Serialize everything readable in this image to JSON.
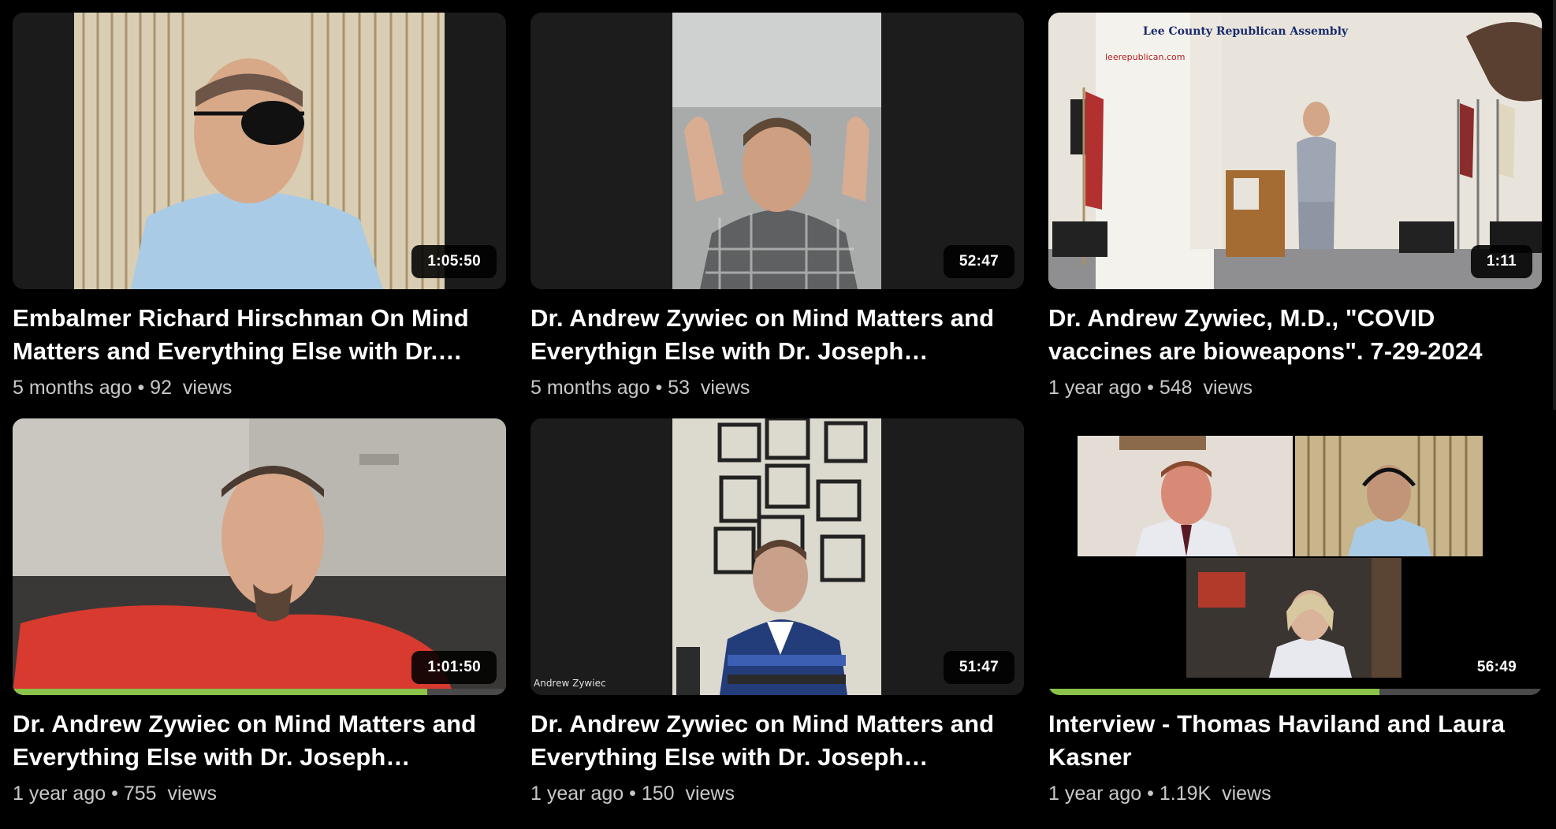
{
  "videos": [
    {
      "title": "Embalmer Richard Hirschman On Mind Matters and Everything Else with Dr.…",
      "duration": "1:05:50",
      "age": "5 months ago",
      "views": "92",
      "views_label": "views",
      "progress": 0
    },
    {
      "title": "Dr. Andrew Zywiec on Mind Matters and Everythign Else with Dr. Joseph…",
      "duration": "52:47",
      "age": "5 months ago",
      "views": "53",
      "views_label": "views",
      "progress": 0
    },
    {
      "title": "Dr. Andrew Zywiec, M.D., \"COVID vaccines are bioweapons\". 7-29-2024",
      "duration": "1:11",
      "age": "1 year ago",
      "views": "548",
      "views_label": "views",
      "progress": 0
    },
    {
      "title": "Dr. Andrew Zywiec on Mind Matters and Everything Else with Dr. Joseph…",
      "duration": "1:01:50",
      "age": "1 year ago",
      "views": "755",
      "views_label": "views",
      "progress": 0.84
    },
    {
      "title": "Dr. Andrew Zywiec on Mind Matters and Everything Else with Dr. Joseph…",
      "duration": "51:47",
      "age": "1 year ago",
      "views": "150",
      "views_label": "views",
      "progress": 0
    },
    {
      "title": "Interview - Thomas Haviland and Laura Kasner",
      "duration": "56:49",
      "age": "1 year ago",
      "views": "1.19K",
      "views_label": "views",
      "progress": 0.67
    }
  ],
  "separator": "•",
  "thumbnail_captions": {
    "v1_overlay": "Lee County Republican Assembly",
    "v1_site": "leerepublican.com",
    "v4_caption": "Andrew Zywiec"
  },
  "colors": {
    "background": "#000000",
    "progress": "#8bc34a",
    "meta_text": "#c8c8c8"
  }
}
